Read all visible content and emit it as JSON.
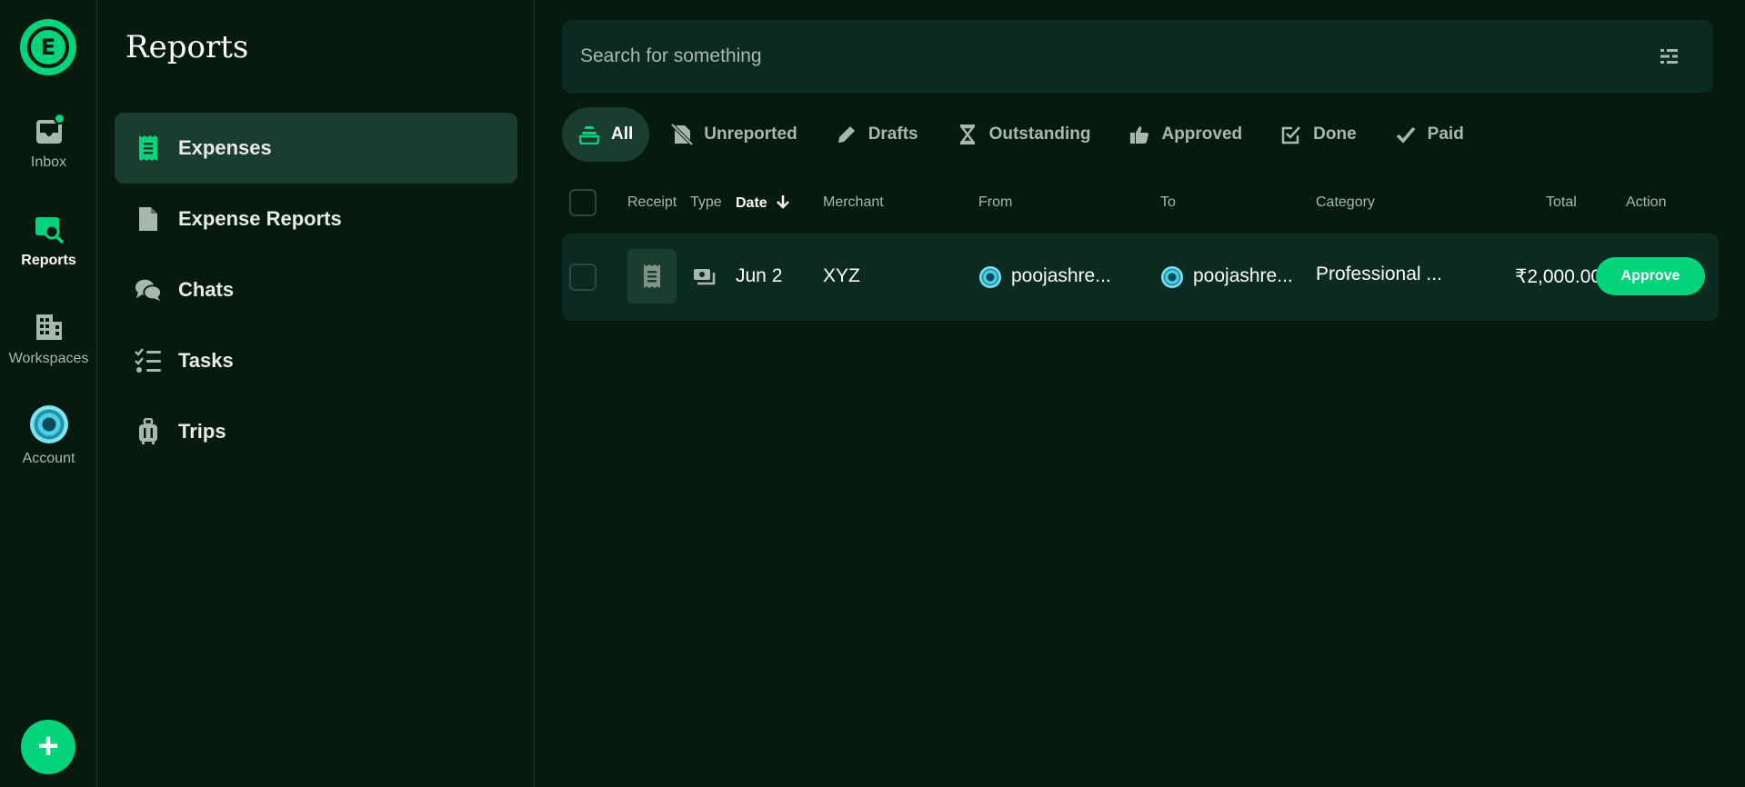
{
  "rail": {
    "logo_letter": "E",
    "items": [
      {
        "label": "Inbox"
      },
      {
        "label": "Reports"
      },
      {
        "label": "Workspaces"
      },
      {
        "label": "Account"
      }
    ],
    "fab_label": "+"
  },
  "subnav": {
    "title": "Reports",
    "items": [
      {
        "label": "Expenses",
        "icon": "receipt-icon"
      },
      {
        "label": "Expense Reports",
        "icon": "document-icon"
      },
      {
        "label": "Chats",
        "icon": "chat-bubbles-icon"
      },
      {
        "label": "Tasks",
        "icon": "checklist-icon"
      },
      {
        "label": "Trips",
        "icon": "luggage-icon"
      }
    ]
  },
  "search": {
    "placeholder": "Search for something"
  },
  "tabs": [
    {
      "label": "All",
      "icon": "stack-icon"
    },
    {
      "label": "Unreported",
      "icon": "no-document-icon"
    },
    {
      "label": "Drafts",
      "icon": "pencil-icon"
    },
    {
      "label": "Outstanding",
      "icon": "hourglass-icon"
    },
    {
      "label": "Approved",
      "icon": "thumbs-up-icon"
    },
    {
      "label": "Done",
      "icon": "checkbox-icon"
    },
    {
      "label": "Paid",
      "icon": "check-icon"
    }
  ],
  "table": {
    "columns": {
      "receipt": "Receipt",
      "type": "Type",
      "date": "Date",
      "merchant": "Merchant",
      "from": "From",
      "to": "To",
      "category": "Category",
      "total": "Total",
      "action": "Action"
    },
    "rows": [
      {
        "date": "Jun 2",
        "merchant": "XYZ",
        "from": "poojashre...",
        "to": "poojashre...",
        "category": "Professional ...",
        "total": "₹2,000.00",
        "action": "Approve"
      }
    ]
  },
  "colors": {
    "background": "#061a0f",
    "accent": "#03d47c",
    "active_bg": "#1a3d2f",
    "card_bg": "#0b2a21"
  }
}
